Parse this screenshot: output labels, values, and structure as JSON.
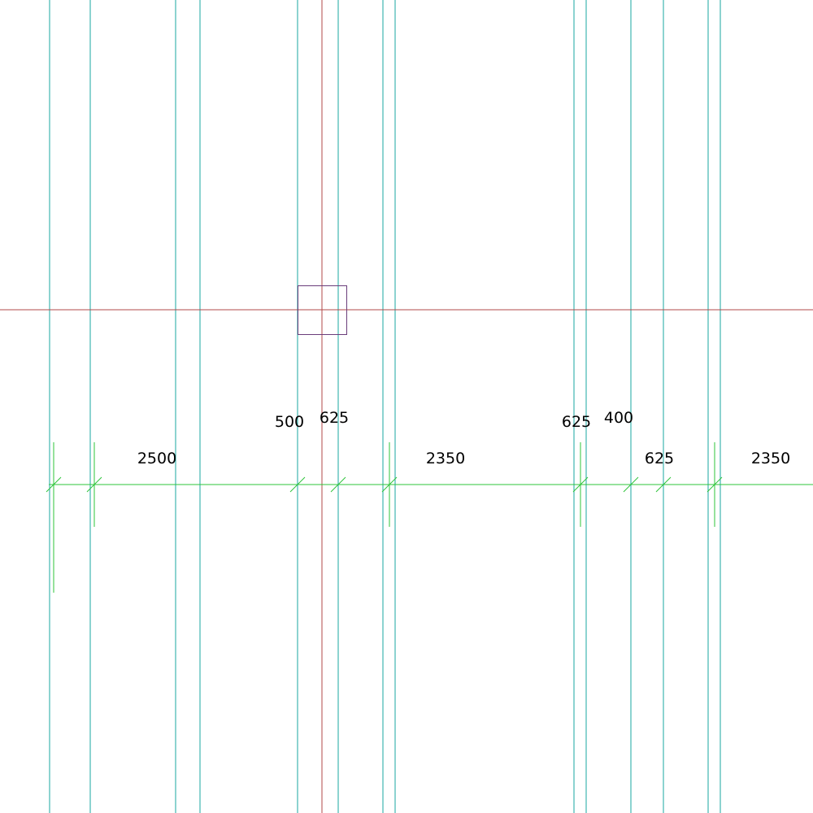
{
  "colors": {
    "background": "#ffffff",
    "grid_line": "#1aa7a0",
    "axis_line": "#b24a4a",
    "dimension_line": "#2ec43a",
    "selection_box": "#6a3d7a",
    "text": "#000000"
  },
  "dimensions": {
    "d1": "2500",
    "d2": "500",
    "d3": "625",
    "d4": "2350",
    "d5": "625",
    "d6": "400",
    "d7": "625",
    "d8": "2350"
  }
}
